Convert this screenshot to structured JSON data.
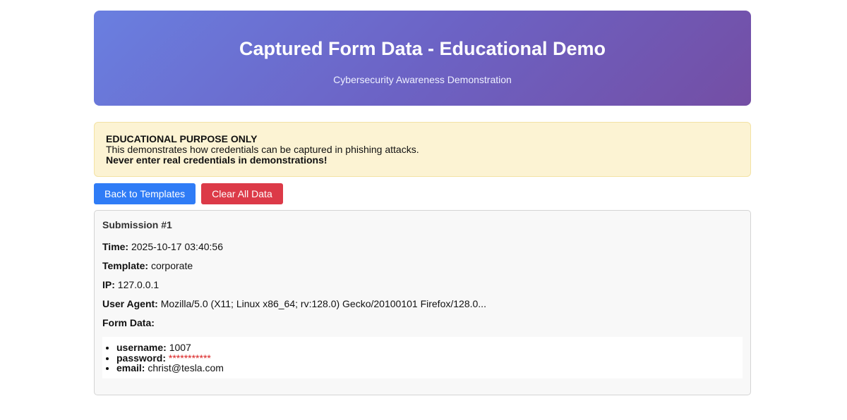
{
  "header": {
    "title": "Captured Form Data - Educational Demo",
    "subtitle": "Cybersecurity Awareness Demonstration"
  },
  "warning": {
    "heading": "EDUCATIONAL PURPOSE ONLY",
    "text": "This demonstrates how credentials can be captured in phishing attacks.",
    "emphasis": "Never enter real credentials in demonstrations!"
  },
  "buttons": {
    "back": "Back to Templates",
    "clear": "Clear All Data"
  },
  "colors": {
    "header_gradient_start": "#6a7fe0",
    "header_gradient_end": "#744ea4",
    "warning_bg": "#fcf3d3",
    "primary_button": "#2f7cf6",
    "danger_button": "#dc3a48",
    "masked_text": "#d92020"
  },
  "submission": {
    "title": "Submission #1",
    "time_label": "Time:",
    "time_value": "2025-10-17 03:40:56",
    "template_label": "Template:",
    "template_value": "corporate",
    "ip_label": "IP:",
    "ip_value": "127.0.0.1",
    "ua_label": "User Agent:",
    "ua_value": "Mozilla/5.0 (X11; Linux x86_64; rv:128.0) Gecko/20100101 Firefox/128.0...",
    "form_data_label": "Form Data:",
    "form_data": [
      {
        "key": "username:",
        "value": "1007"
      },
      {
        "key": "password:",
        "value": "***********"
      },
      {
        "key": "email:",
        "value": "christ@tesla.com"
      }
    ]
  }
}
